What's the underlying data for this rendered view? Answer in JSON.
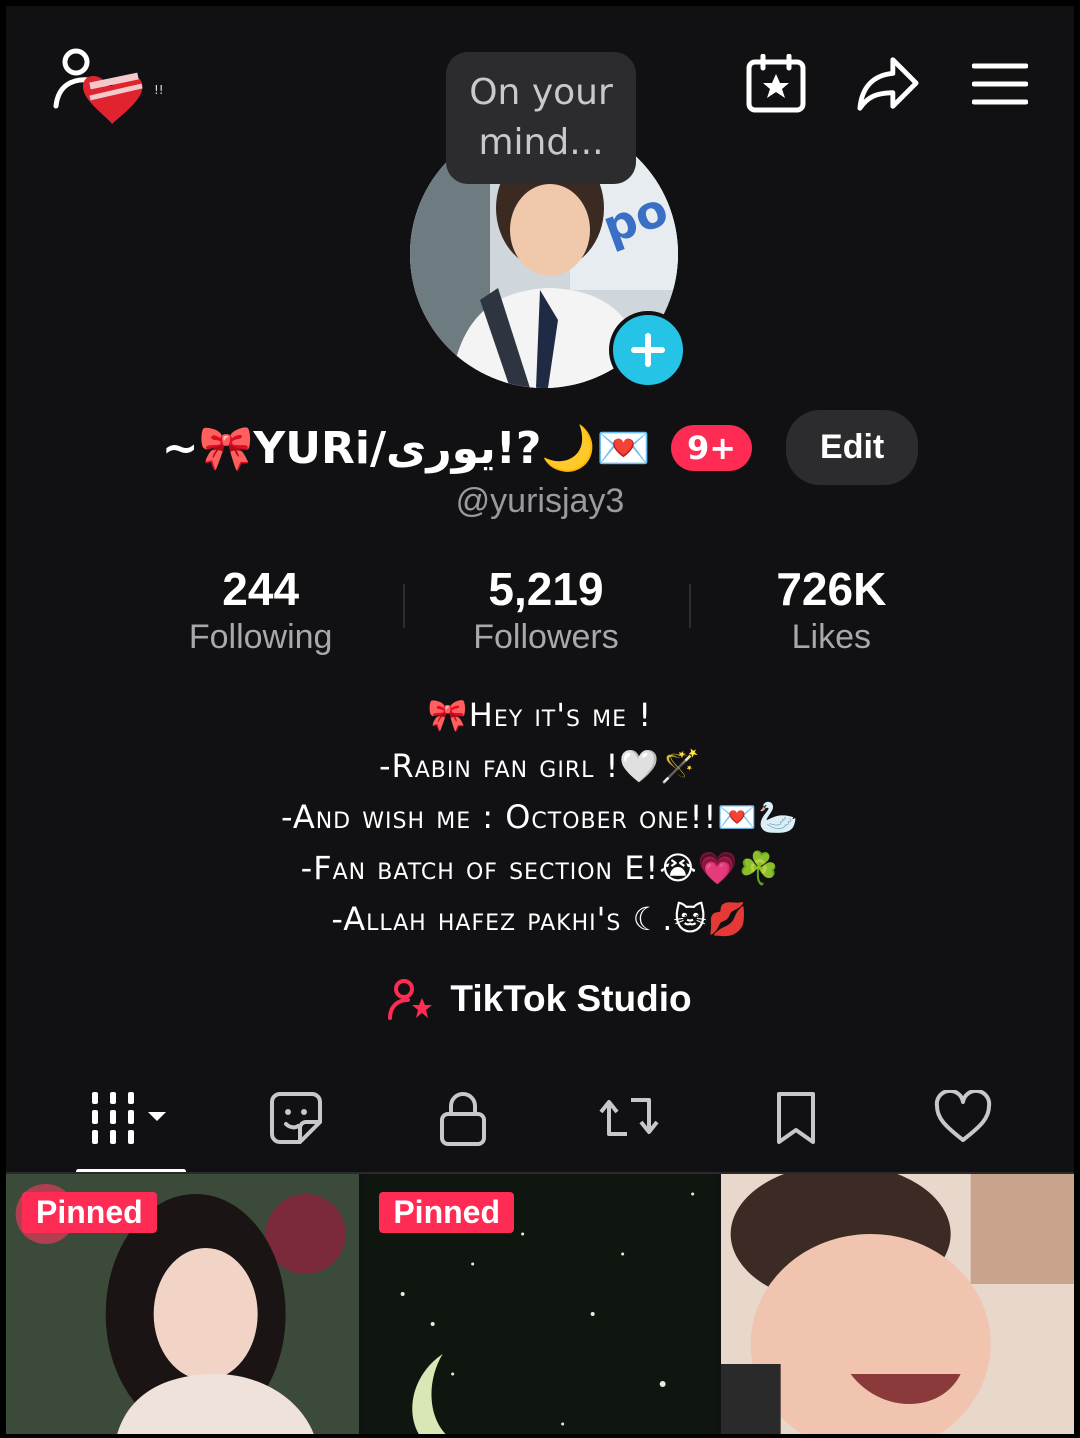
{
  "header": {
    "mind_bubble_line1": "On your",
    "mind_bubble_line2": "mind...",
    "icons": [
      "add-friends-icon",
      "calendar-star-icon",
      "share-icon",
      "menu-icon"
    ]
  },
  "profile": {
    "display_name": "~🎀YURi/یوری!?🌙💌",
    "notification_count": "9+",
    "edit_label": "Edit",
    "username": "@yurisjay3"
  },
  "stats": [
    {
      "value": "244",
      "label": "Following"
    },
    {
      "value": "5,219",
      "label": "Followers"
    },
    {
      "value": "726K",
      "label": "Likes"
    }
  ],
  "bio": [
    "🎀Hey it's me !",
    "-Rabin fan girl !🤍🪄",
    "-And wish me : October one!!💌🦢",
    "-Fan batch of section E!😭💗☘️",
    "-Allah hafez pakhi's ☾.🐱💋"
  ],
  "studio_label": "TikTok Studio",
  "tabs": [
    "videos-grid-icon",
    "sticker-icon",
    "lock-icon",
    "repost-icon",
    "bookmark-icon",
    "heart-icon"
  ],
  "videos": [
    {
      "badge": "Pinned"
    },
    {
      "badge": "Pinned"
    },
    {
      "badge": ""
    }
  ],
  "colors": {
    "accent": "#fe2c55",
    "add_button": "#25c4e6",
    "background": "#111113",
    "secondary_button": "#2c2c2e"
  }
}
